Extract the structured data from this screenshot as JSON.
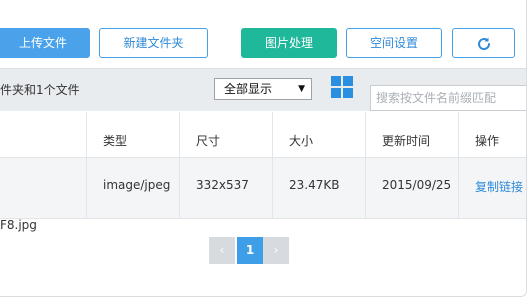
{
  "toolbar": {
    "upload_label": "上传文件",
    "new_folder_label": "新建文件夹",
    "image_process_label": "图片处理",
    "space_settings_label": "空间设置",
    "refresh_icon": "refresh-icon"
  },
  "infobar": {
    "summary_text": "件夹和1个文件",
    "filter_value": "全部显示",
    "view_icon": "grid-view-icon",
    "search_placeholder": "搜索按文件名前缀匹配"
  },
  "table": {
    "headers": {
      "type": "类型",
      "size": "尺寸",
      "filesize": "大小",
      "updated": "更新时间",
      "actions": "操作"
    },
    "rows": [
      {
        "type": "image/jpeg",
        "size": "332x537",
        "filesize": "23.47KB",
        "updated": "2015/09/25",
        "action": "复制链接"
      }
    ]
  },
  "filename_text": "F8.jpg",
  "pagination": {
    "prev": "‹",
    "current": "1",
    "next": "›"
  },
  "colors": {
    "primary": "#4aa3ea",
    "success": "#1fb89b",
    "link": "#2f8ad8"
  }
}
